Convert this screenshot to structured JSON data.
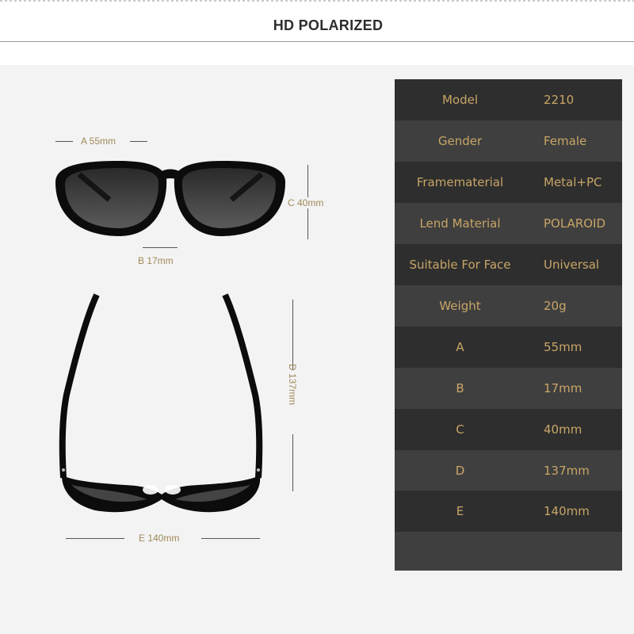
{
  "heading": "HD POLARIZED",
  "dimensions": {
    "a": "A 55mm",
    "b": "B 17mm",
    "c": "C 40mm",
    "d": "D 137mm",
    "e": "E 140mm"
  },
  "specs": [
    {
      "label": "Model",
      "value": "2210"
    },
    {
      "label": "Gender",
      "value": "Female"
    },
    {
      "label": "Framematerial",
      "value": "Metal+PC"
    },
    {
      "label": "Lend Material",
      "value": "POLAROID"
    },
    {
      "label": "Suitable For Face",
      "value": "Universal"
    },
    {
      "label": "Weight",
      "value": "20g"
    },
    {
      "label": "A",
      "value": "55mm"
    },
    {
      "label": "B",
      "value": "17mm"
    },
    {
      "label": "C",
      "value": "40mm"
    },
    {
      "label": "D",
      "value": "137mm"
    },
    {
      "label": "E",
      "value": "140mm"
    }
  ],
  "colors": {
    "spec_text": "#c8a567",
    "row_dark": "#2e2e2e",
    "row_light": "#3f3f3f",
    "dimension_text": "#a08a5a"
  }
}
